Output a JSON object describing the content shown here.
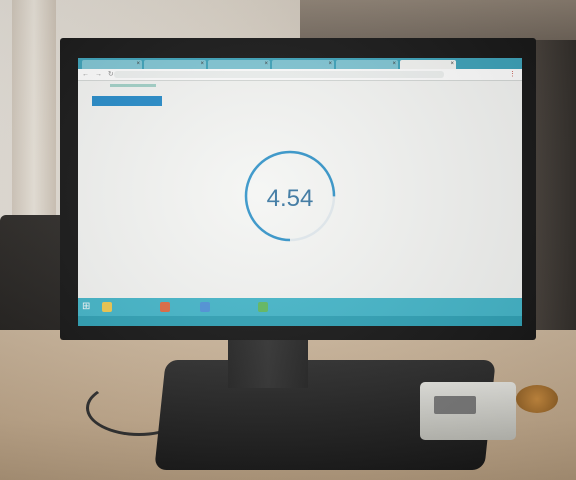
{
  "browser": {
    "tabs": [
      {
        "label": "",
        "active": false
      },
      {
        "label": "",
        "active": false
      },
      {
        "label": "",
        "active": false
      },
      {
        "label": "",
        "active": false
      },
      {
        "label": "",
        "active": false
      },
      {
        "label": "",
        "active": true
      }
    ],
    "nav_glyphs": "← → ↻",
    "menu_glyph": "⋮"
  },
  "page": {
    "primary_button": "",
    "nav": [
      {
        "label": "",
        "active": true
      },
      {
        "label": "",
        "active": false
      },
      {
        "label": "",
        "active": false
      },
      {
        "label": "",
        "active": false
      },
      {
        "label": "",
        "active": false
      }
    ],
    "metrics": [
      {
        "label": "",
        "value": ""
      },
      {
        "label": "",
        "value": ""
      }
    ],
    "server_link": "",
    "gauge": {
      "title": "",
      "value": "4.54",
      "unit": "",
      "progress": 0.75
    }
  },
  "taskbar": {
    "start_glyph": "⊞",
    "clock": ""
  },
  "colors": {
    "accent": "#1f88c8",
    "gauge_ring": "#2a8fc6",
    "taskbar": "#3fb5c9"
  }
}
